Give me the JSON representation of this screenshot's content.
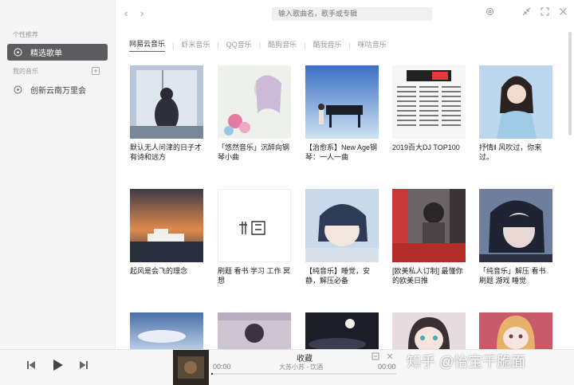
{
  "sidebar": {
    "section_1": "个性推荐",
    "items_top": [
      {
        "label": "精选歌单"
      }
    ],
    "section_2": "我的音乐",
    "items_bottom": [
      {
        "label": "创新云南万里会"
      }
    ]
  },
  "topbar": {
    "search_placeholder": "输入歌曲名，歌手或专辑"
  },
  "tabs": [
    {
      "label": "网易云音乐"
    },
    {
      "label": "虾米音乐"
    },
    {
      "label": "QQ音乐"
    },
    {
      "label": "酷狗音乐"
    },
    {
      "label": "酷我音乐"
    },
    {
      "label": "咪咕音乐"
    }
  ],
  "playlists": [
    {
      "title": "默认无人问津的日子才有诗和远方",
      "accent": "#8fa4c2"
    },
    {
      "title": "「悠然音乐」沉醉向钢琴小曲",
      "accent": "#d9c4dc"
    },
    {
      "title": "【治愈系】New Age钢琴：一人一曲",
      "accent": "#5d8fd0"
    },
    {
      "title": "2019百大DJ TOP100",
      "accent": "#e9e9e9"
    },
    {
      "title": "抒情‖ 风吹过，你来过。",
      "accent": "#7fb5e0"
    },
    {
      "title": "起风是会飞的理念",
      "accent": "#c27a4a"
    },
    {
      "title": "刷题 看书 学习 工作 冥想",
      "accent": "#ffffff"
    },
    {
      "title": "【纯音乐】睡觉，安静，解压必备",
      "accent": "#6f8fb8"
    },
    {
      "title": "[欧美私人订制] 最懂你的欧美日推",
      "accent": "#b03a3a"
    },
    {
      "title": "「纯音乐」解压 看书 刷题 游戏 睡觉",
      "accent": "#3d4d6d"
    },
    {
      "title": "",
      "accent": "#5a7fb0"
    },
    {
      "title": "",
      "accent": "#c0b8c8"
    },
    {
      "title": "",
      "accent": "#222230"
    },
    {
      "title": "",
      "accent": "#d8c0c8"
    },
    {
      "title": "",
      "accent": "#b85a6a"
    }
  ],
  "player": {
    "song": "收藏",
    "artist": "大苏小苏 - 饮酒",
    "time_current": "00:00",
    "time_total": "00:00",
    "progress": 0.01
  },
  "watermark": "知乎 @怡宝干脆面"
}
